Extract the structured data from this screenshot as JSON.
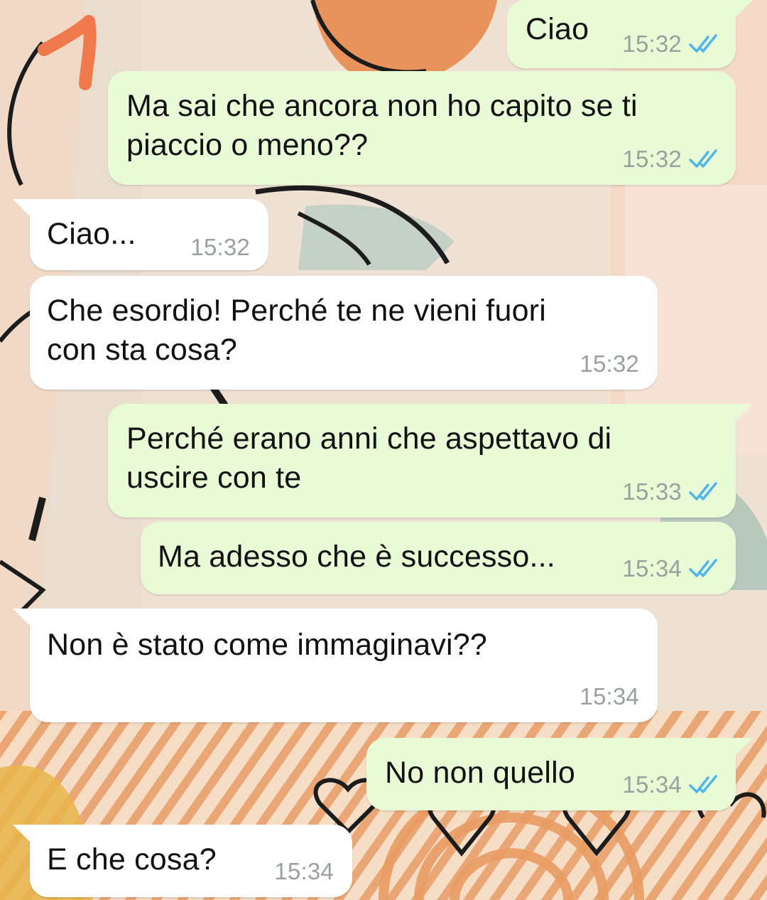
{
  "conversation": {
    "messages": [
      {
        "direction": "outgoing",
        "text": "Ciao",
        "time": "15:32",
        "status_icon": "read-receipt-double-check-icon"
      },
      {
        "direction": "outgoing",
        "text": "Ma sai che ancora non ho capito se ti\npiaccio o meno??",
        "time": "15:32",
        "status_icon": "read-receipt-double-check-icon"
      },
      {
        "direction": "incoming",
        "text": "Ciao...",
        "time": "15:32"
      },
      {
        "direction": "incoming",
        "text": "Che esordio! Perché te ne vieni fuori\ncon sta cosa?",
        "time": "15:32"
      },
      {
        "direction": "outgoing",
        "text": "Perché erano anni che aspettavo di\nuscire con te",
        "time": "15:33",
        "status_icon": "read-receipt-double-check-icon"
      },
      {
        "direction": "outgoing",
        "text": "Ma adesso che è successo...",
        "time": "15:34",
        "status_icon": "read-receipt-double-check-icon"
      },
      {
        "direction": "incoming",
        "text": "Non è stato come immaginavi??",
        "time": "15:34"
      },
      {
        "direction": "outgoing",
        "text": "No non quello",
        "time": "15:34",
        "status_icon": "read-receipt-double-check-icon"
      },
      {
        "direction": "incoming",
        "text": "E che cosa?",
        "time": "15:34"
      }
    ]
  },
  "annotation": {
    "text": "1",
    "color": "#f07a4e"
  },
  "colors": {
    "outgoing_bubble": "#e8fbd6",
    "incoming_bubble": "#ffffff",
    "read_receipt": "#4fb6ec",
    "timestamp": "#9aa19d",
    "wallpaper_orange": "#e8935c",
    "wallpaper_peach": "#f2c7a3",
    "wallpaper_sage": "#a9bcae"
  }
}
